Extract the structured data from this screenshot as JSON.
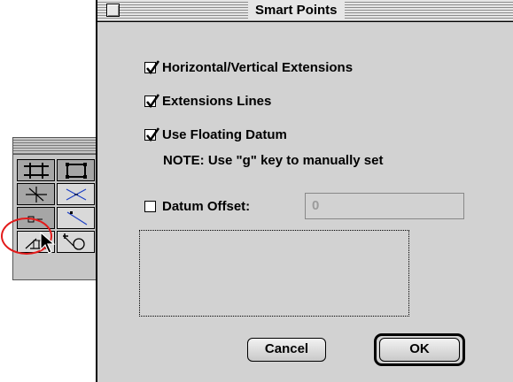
{
  "window": {
    "title": "Smart Points"
  },
  "options": {
    "horizontal_vertical_extensions": {
      "label": "Horizontal/Vertical Extensions",
      "checked": true
    },
    "extensions_lines": {
      "label": "Extensions Lines",
      "checked": true
    },
    "use_floating_datum": {
      "label": "Use Floating Datum",
      "checked": true
    },
    "note": "NOTE: Use \"g\" key to manually set",
    "datum_offset": {
      "label": "Datum Offset:",
      "checked": false,
      "value": "0"
    }
  },
  "buttons": {
    "cancel": "Cancel",
    "ok": "OK"
  },
  "palette": {
    "tools": [
      "grid-snap-icon",
      "frame-snap-icon",
      "perpendicular-snap-icon",
      "intersection-snap-icon",
      "point-snap-icon",
      "tangent-line-snap-icon",
      "angle-snap-icon",
      "circle-snap-icon"
    ],
    "highlight_color": "#e31b1b"
  }
}
